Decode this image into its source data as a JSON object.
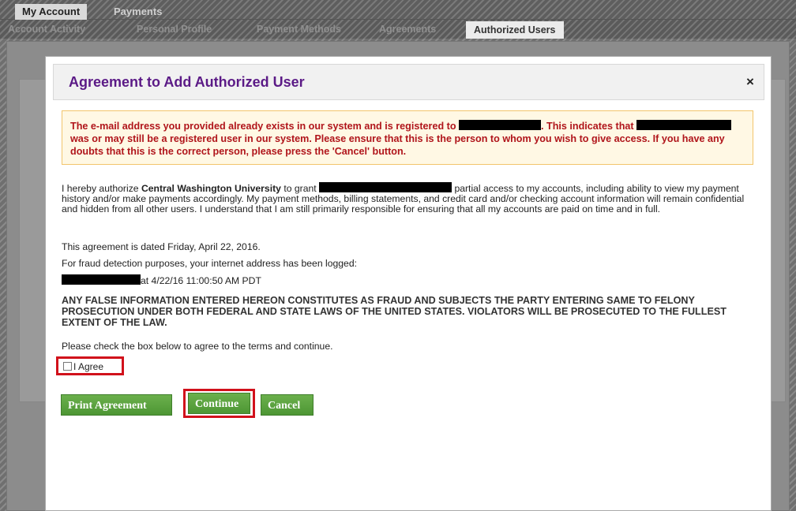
{
  "top_tabs": [
    {
      "label": "My Account",
      "active": true
    },
    {
      "label": "Payments",
      "active": false
    }
  ],
  "sub_tabs": [
    {
      "label": "Account Activity",
      "active": false
    },
    {
      "label": "Personal Profile",
      "active": false
    },
    {
      "label": "Payment Methods",
      "active": false
    },
    {
      "label": "Agreements",
      "active": false
    },
    {
      "label": "Authorized Users",
      "active": true
    }
  ],
  "modal": {
    "title": "Agreement to Add Authorized User",
    "close_label": "×",
    "warning": {
      "part1": "The e-mail address you provided already exists in our system and is registered to",
      "part2": ". This indicates that",
      "part3": "was or may still be a registered user in our system. Please ensure that this is the person to whom you wish to give access. If you have any doubts that this is the correct person, please press the 'Cancel' button."
    },
    "auth_pre": "I hereby authorize",
    "auth_org": "Central Washington University",
    "auth_mid": "to grant",
    "auth_post": "partial access to my accounts, including ability to view my payment history and/or make payments accordingly. My payment methods, billing statements, and credit card and/or checking account information will remain confidential and hidden from all other users. I understand that I am still primarily responsible for ensuring that all my accounts are paid on time and in full.",
    "dated": "This agreement is dated Friday, April 22, 2016.",
    "fraud_note": "For fraud detection purposes, your internet address has been logged:",
    "logged_at": "at 4/22/16 11:00:50 AM PDT",
    "legal": "ANY FALSE INFORMATION ENTERED HEREON CONSTITUTES AS FRAUD AND SUBJECTS THE PARTY ENTERING SAME TO FELONY PROSECUTION UNDER BOTH FEDERAL AND STATE LAWS OF THE UNITED STATES. VIOLATORS WILL BE PROSECUTED TO THE FULLEST EXTENT OF THE LAW.",
    "check_prompt": "Please check the box below to agree to the terms and continue.",
    "agree_label": "I Agree",
    "agree_checked": false,
    "buttons": {
      "print": "Print Agreement",
      "continue": "Continue",
      "cancel": "Cancel"
    }
  },
  "colors": {
    "title": "#5b1a86",
    "warning_text": "#b0151b",
    "warning_bg": "#fff8e4",
    "button": "#5aa23e",
    "highlight": "#d1111b"
  }
}
